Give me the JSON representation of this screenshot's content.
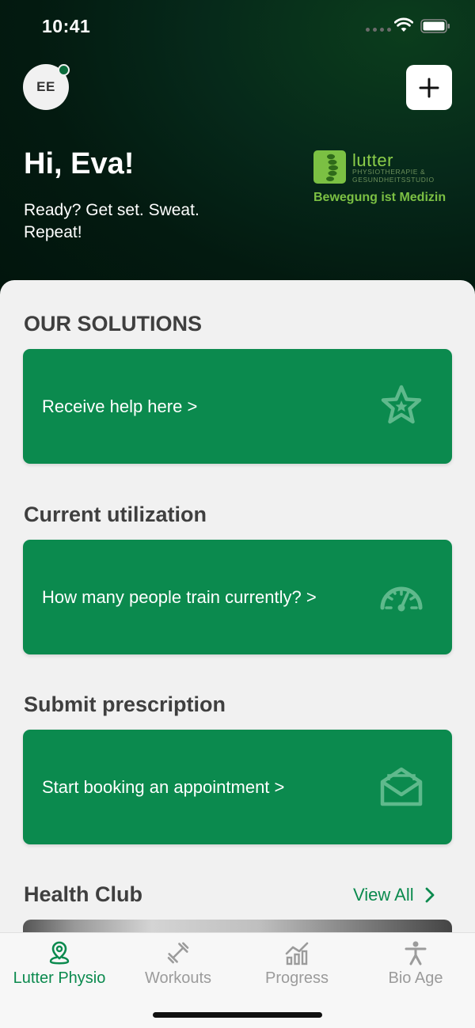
{
  "status_bar": {
    "time": "10:41"
  },
  "header": {
    "avatar_initials": "EE",
    "greeting": "Hi, Eva!",
    "tagline": "Ready? Get set. Sweat. Repeat!",
    "logo": {
      "name": "lutter",
      "subtitle": "PHYSIOTHERAPIE & GESUNDHEITSSTUDIO",
      "motto": "Bewegung ist Medizin"
    }
  },
  "sections": {
    "solutions": {
      "title": "OUR SOLUTIONS",
      "card_label": "Receive help here >",
      "icon": "star-icon"
    },
    "utilization": {
      "title": "Current utilization",
      "card_label": "How many people train currently? >",
      "icon": "gauge-icon"
    },
    "prescription": {
      "title": "Submit prescription",
      "card_label": "Start booking an appointment  >",
      "icon": "envelope-icon"
    },
    "health_club": {
      "title": "Health Club",
      "view_all": "View All"
    }
  },
  "tabs": [
    {
      "label": "Lutter Physio",
      "icon": "location-pin-icon",
      "active": true
    },
    {
      "label": "Workouts",
      "icon": "dumbbell-icon",
      "active": false
    },
    {
      "label": "Progress",
      "icon": "chart-icon",
      "active": false
    },
    {
      "label": "Bio Age",
      "icon": "person-icon",
      "active": false
    }
  ],
  "colors": {
    "accent": "#0b8a4e",
    "header_bg": "#06291a",
    "logo_green": "#7bc043"
  }
}
